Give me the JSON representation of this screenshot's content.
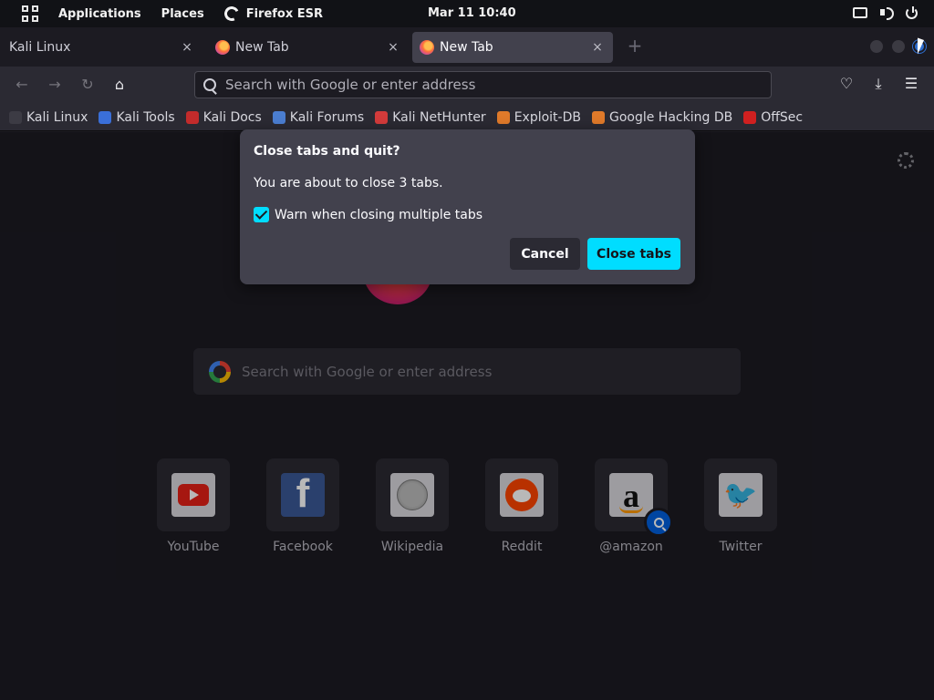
{
  "panel": {
    "applications": "Applications",
    "places": "Places",
    "app_name": "Firefox ESR",
    "clock": "Mar 11  10:40"
  },
  "tabs": [
    {
      "label": "Kali Linux"
    },
    {
      "label": "New Tab"
    },
    {
      "label": "New Tab"
    }
  ],
  "tab_close_glyph": "×",
  "new_tab_glyph": "+",
  "navbar": {
    "placeholder": "Search with Google or enter address"
  },
  "bookmarks": [
    {
      "label": "Kali Linux",
      "color": "#3c3b44"
    },
    {
      "label": "Kali Tools",
      "color": "#3a6fd8"
    },
    {
      "label": "Kali Docs",
      "color": "#c22b2b"
    },
    {
      "label": "Kali Forums",
      "color": "#4b7ed1"
    },
    {
      "label": "Kali NetHunter",
      "color": "#d33b3b"
    },
    {
      "label": "Exploit-DB",
      "color": "#e07a2a"
    },
    {
      "label": "Google Hacking DB",
      "color": "#e07a2a"
    },
    {
      "label": "OffSec",
      "color": "#d02020"
    }
  ],
  "content": {
    "search_placeholder": "Search with Google or enter address",
    "tiles": [
      {
        "name": "YouTube"
      },
      {
        "name": "Facebook",
        "glyph": "f"
      },
      {
        "name": "Wikipedia"
      },
      {
        "name": "Reddit"
      },
      {
        "name": "@amazon",
        "glyph": "a"
      },
      {
        "name": "Twitter",
        "glyph": "🐦"
      }
    ]
  },
  "dialog": {
    "title": "Close tabs and quit?",
    "message": "You are about to close 3 tabs.",
    "checkbox_label": "Warn when closing multiple tabs",
    "checkbox_checked": true,
    "cancel_label": "Cancel",
    "confirm_label": "Close tabs"
  }
}
